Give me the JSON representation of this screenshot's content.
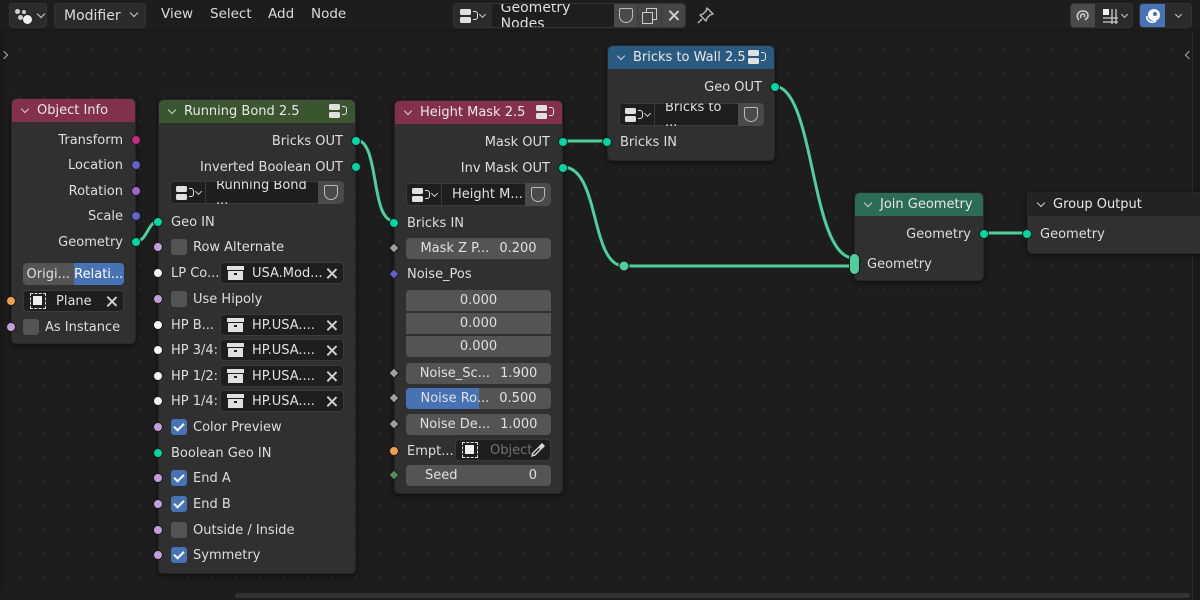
{
  "header": {
    "editor_type_icon": "node-editor-icon",
    "mode_label": "Modifier",
    "menu": [
      "View",
      "Select",
      "Add",
      "Node"
    ],
    "node_tree_name": "Geometry Nodes",
    "icons": {
      "fake_user": "shield-icon",
      "duplicate": "duplicate-icon",
      "unlink": "close-icon",
      "pin": "pin-icon",
      "snap": "magnet-icon",
      "snap_options": "snap-grid-icon",
      "overlay": "overlay-icon"
    }
  },
  "colors": {
    "geometry_socket": "#00d6a3",
    "wire": "#4fcf9a",
    "header_object_info": "#83314a",
    "header_running_bond": "#3b5530",
    "header_height_mask": "#83314a",
    "header_bricks_to_wall": "#2a5a7f",
    "header_join_geometry": "#2c6b56",
    "header_group_output": "#232323",
    "accent_blue": "#4772b3"
  },
  "nodes": {
    "object_info": {
      "title": "Object Info",
      "outputs": [
        "Transform",
        "Location",
        "Rotation",
        "Scale",
        "Geometry"
      ],
      "transform_space": [
        "Origi...",
        "Relati..."
      ],
      "transform_space_active": "Relati...",
      "object_value": "Plane",
      "as_instance_label": "As Instance",
      "as_instance_checked": false
    },
    "running_bond": {
      "title": "Running Bond 2.5",
      "outputs": [
        "Bricks OUT",
        "Inverted Boolean OUT"
      ],
      "group_name": "Running Bond ...",
      "geo_in_label": "Geo IN",
      "row_alternate": {
        "label": "Row Alternate",
        "checked": false
      },
      "lp_collection": {
        "label": "LP Co...",
        "value": "USA.Mod..."
      },
      "use_hipoly": {
        "label": "Use Hipoly",
        "checked": false
      },
      "hp_collections": [
        {
          "label": "HP B...",
          "value": "HP.USA...."
        },
        {
          "label": "HP 3/4:",
          "value": "HP.USA...."
        },
        {
          "label": "HP 1/2:",
          "value": "HP.USA...."
        },
        {
          "label": "HP 1/4:",
          "value": "HP.USA...."
        }
      ],
      "color_preview": {
        "label": "Color Preview",
        "checked": true
      },
      "boolean_geo_in_label": "Boolean Geo IN",
      "end_a": {
        "label": "End A",
        "checked": true
      },
      "end_b": {
        "label": "End B",
        "checked": true
      },
      "outside_inside": {
        "label": "Outside / Inside",
        "checked": false
      },
      "symmetry": {
        "label": "Symmetry",
        "checked": true
      }
    },
    "height_mask": {
      "title": "Height Mask 2.5",
      "outputs": [
        "Mask OUT",
        "Inv Mask OUT"
      ],
      "group_name": "Height M...",
      "bricks_in_label": "Bricks IN",
      "mask_z": {
        "label": "Mask Z P...",
        "value": "0.200"
      },
      "noise_pos_label": "Noise_Pos",
      "noise_pos_values": [
        "0.000",
        "0.000",
        "0.000"
      ],
      "noise_scale": {
        "label": "Noise_Sc...",
        "value": "1.900"
      },
      "noise_roughness": {
        "label": "Noise Ro...",
        "value": "0.500",
        "fraction": 0.5
      },
      "noise_detail": {
        "label": "Noise De...",
        "value": "1.000"
      },
      "empty": {
        "label": "Empt...",
        "placeholder": "Object"
      },
      "seed": {
        "label": "Seed",
        "value": "0"
      }
    },
    "bricks_to_wall": {
      "title": "Bricks to Wall 2.5",
      "output": "Geo OUT",
      "group_name": "Bricks to ...",
      "input": "Bricks IN"
    },
    "join_geometry": {
      "title": "Join Geometry",
      "output": "Geometry",
      "input": "Geometry"
    },
    "group_output": {
      "title": "Group Output",
      "input": "Geometry"
    }
  }
}
